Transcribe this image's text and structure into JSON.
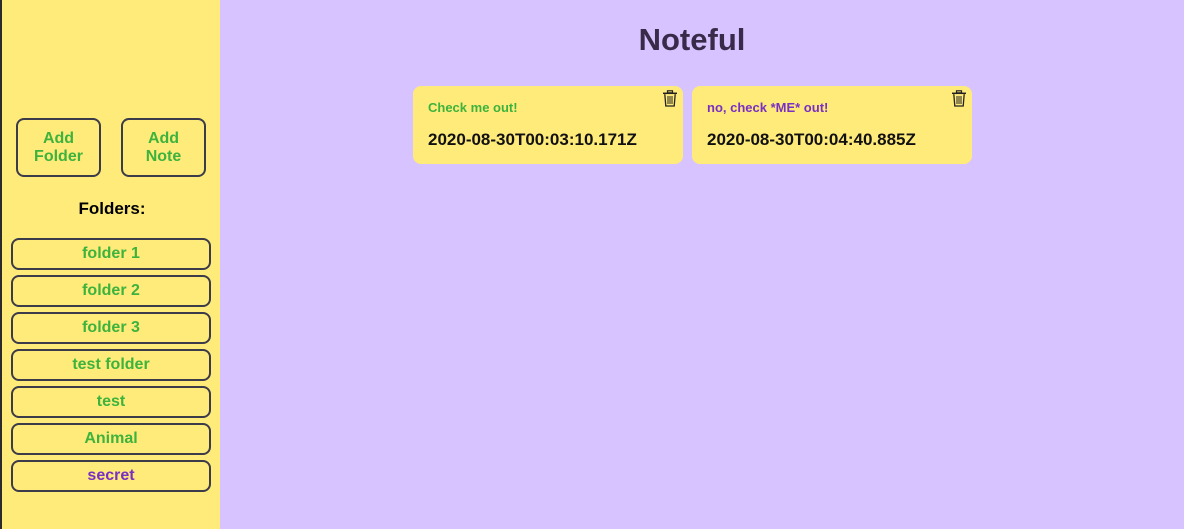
{
  "app": {
    "title": "Noteful"
  },
  "sidebar": {
    "add_folder_label": "Add Folder",
    "add_note_label": "Add Note",
    "folders_heading": "Folders:",
    "folders": [
      {
        "label": "folder 1",
        "active": false
      },
      {
        "label": "folder 2",
        "active": false
      },
      {
        "label": "folder 3",
        "active": false
      },
      {
        "label": "test folder",
        "active": false
      },
      {
        "label": "test",
        "active": false
      },
      {
        "label": "Animal",
        "active": false
      },
      {
        "label": "secret",
        "active": true
      }
    ]
  },
  "notes": [
    {
      "name": "Check me out!",
      "modified": "2020-08-30T00:03:10.171Z",
      "delete_icon": "trash-icon"
    },
    {
      "name": "no, check *ME* out!",
      "modified": "2020-08-30T00:04:40.885Z",
      "delete_icon": "trash-icon"
    }
  ],
  "colors": {
    "sidebar_bg": "#ffeb7a",
    "main_bg": "#d6c3ff",
    "link_green": "#3db33d",
    "active_purple": "#7a2fc4",
    "border": "#3b3b4a"
  }
}
